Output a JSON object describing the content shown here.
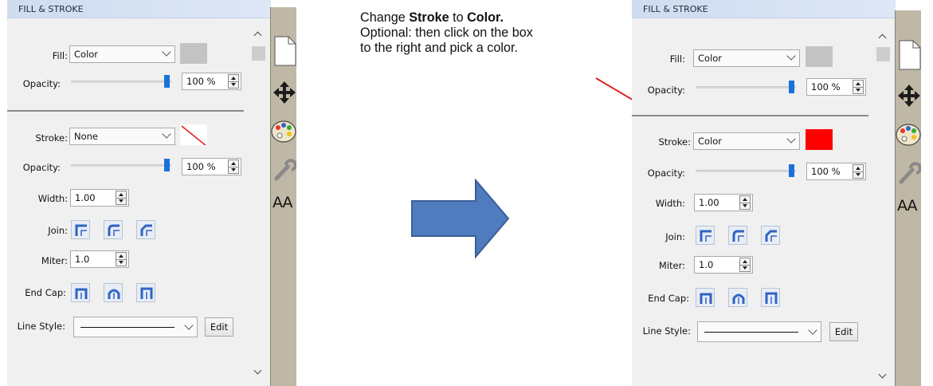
{
  "instructions": {
    "line1_prefix": "Change ",
    "line1_bold1": "Stroke",
    "line1_mid": " to ",
    "line1_bold2": "Color.",
    "line2": "Optional: then click on the box",
    "line3": "to the right and pick a color."
  },
  "panels": [
    {
      "id": "before",
      "header": "FILL & STROKE",
      "fill": {
        "label": "Fill:",
        "value": "Color",
        "swatch_color": "#c3c3c3",
        "opacity_label": "Opacity:",
        "opacity": "100 %",
        "opacity_level": 1.0
      },
      "stroke": {
        "label": "Stroke:",
        "value": "None",
        "swatch": "none-slash",
        "opacity_label": "Opacity:",
        "opacity": "100 %",
        "opacity_level": 1.0
      },
      "width": {
        "label": "Width:",
        "value": "1.00"
      },
      "join": {
        "label": "Join:",
        "options": [
          "miter-join-icon",
          "round-join-icon",
          "bevel-join-icon"
        ]
      },
      "miter": {
        "label": "Miter:",
        "value": "1.0"
      },
      "end_cap": {
        "label": "End Cap:",
        "options": [
          "butt-cap-icon",
          "round-cap-icon",
          "square-cap-icon"
        ]
      },
      "line_style": {
        "label": "Line Style:",
        "edit_label": "Edit"
      }
    },
    {
      "id": "after",
      "header": "FILL & STROKE",
      "fill": {
        "label": "Fill:",
        "value": "Color",
        "swatch_color": "#c3c3c3",
        "opacity_label": "Opacity:",
        "opacity": "100 %",
        "opacity_level": 1.0
      },
      "stroke": {
        "label": "Stroke:",
        "value": "Color",
        "swatch_color": "#ff0000",
        "opacity_label": "Opacity:",
        "opacity": "100 %",
        "opacity_level": 1.0
      },
      "width": {
        "label": "Width:",
        "value": "1.00"
      },
      "join": {
        "label": "Join:",
        "options": [
          "miter-join-icon",
          "round-join-icon",
          "bevel-join-icon"
        ]
      },
      "miter": {
        "label": "Miter:",
        "value": "1.0"
      },
      "end_cap": {
        "label": "End Cap:",
        "options": [
          "butt-cap-icon",
          "round-cap-icon",
          "square-cap-icon"
        ]
      },
      "line_style": {
        "label": "Line Style:",
        "edit_label": "Edit"
      }
    }
  ],
  "sidebar_icons": [
    "document-icon",
    "move-icon",
    "palette-icon",
    "wrench-icon",
    "text-size-icon"
  ],
  "sidebar_text_icon_label": "AA",
  "colors": {
    "accent": "#1a72d9",
    "header": "#d6e2f2",
    "arrow_fill": "#4f7bbf",
    "arrow_stroke": "#3a5f96",
    "pointer": "#e02020"
  }
}
